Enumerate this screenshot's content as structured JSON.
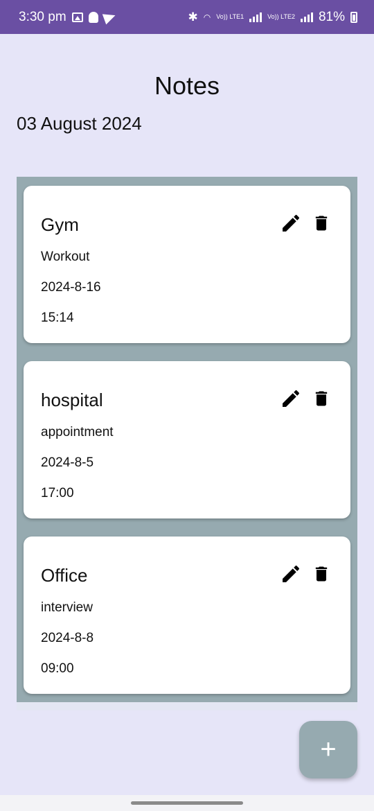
{
  "status_bar": {
    "time": "3:30 pm",
    "battery": "81%",
    "icons": [
      "image-icon",
      "snapchat-icon",
      "telegram-icon",
      "bluetooth-icon",
      "wifi-icon",
      "signal-icon",
      "battery-icon"
    ],
    "lte1": "Vo)) LTE1",
    "lte2": "Vo)) LTE2"
  },
  "header": {
    "title": "Notes",
    "date": "03 August 2024"
  },
  "notes": [
    {
      "title": "Gym",
      "description": "Workout",
      "date": "2024-8-16",
      "time": "15:14"
    },
    {
      "title": "hospital",
      "description": "appointment",
      "date": "2024-8-5",
      "time": "17:00"
    },
    {
      "title": "Office",
      "description": "interview",
      "date": "2024-8-8",
      "time": "09:00"
    }
  ],
  "fab": {
    "label": "+",
    "icon": "add-icon"
  },
  "colors": {
    "status_bar": "#6a4fa3",
    "background": "#e6e5f8",
    "list_background": "#96aab0",
    "card": "#ffffff",
    "fab": "#96aab0"
  }
}
